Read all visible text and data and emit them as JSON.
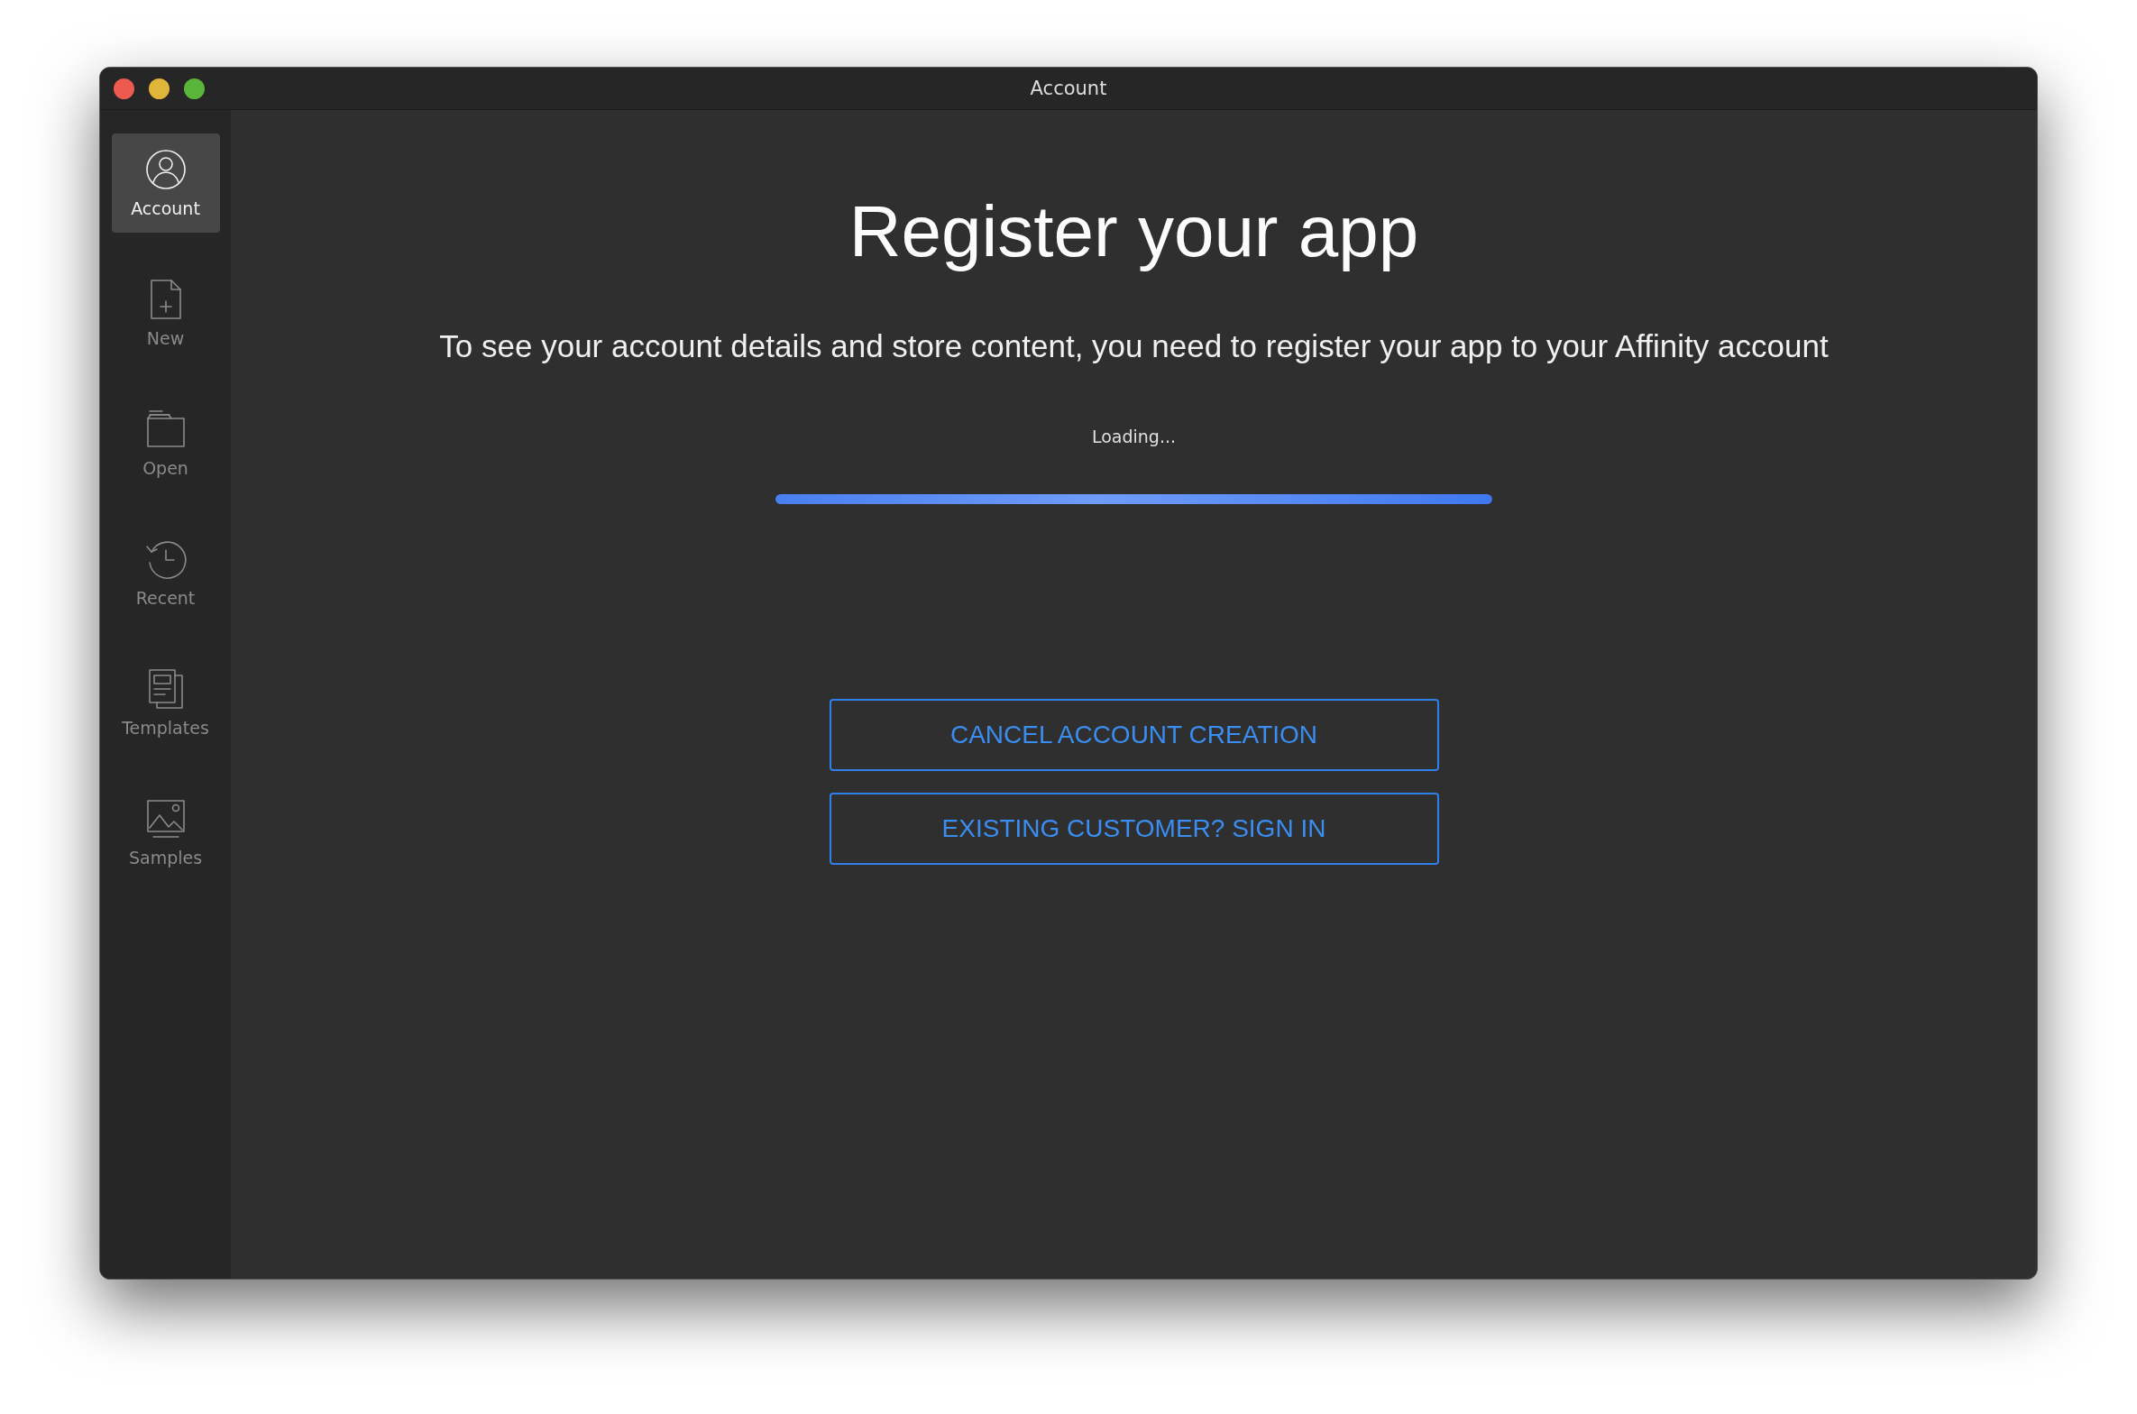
{
  "window": {
    "title": "Account"
  },
  "sidebar": {
    "items": [
      {
        "label": "Account",
        "kind": "account",
        "selected": true
      },
      {
        "label": "New",
        "kind": "new",
        "selected": false
      },
      {
        "label": "Open",
        "kind": "open",
        "selected": false
      },
      {
        "label": "Recent",
        "kind": "recent",
        "selected": false
      },
      {
        "label": "Templates",
        "kind": "templates",
        "selected": false
      },
      {
        "label": "Samples",
        "kind": "samples",
        "selected": false
      }
    ]
  },
  "main": {
    "heading": "Register your app",
    "description": "To see your account details and store content, you need to register your app to your Affinity account",
    "status": "Loading...",
    "progress": {
      "level": 1
    },
    "buttons": [
      "CANCEL ACCOUNT CREATION",
      "EXISTING CUSTOMER? SIGN IN"
    ]
  }
}
